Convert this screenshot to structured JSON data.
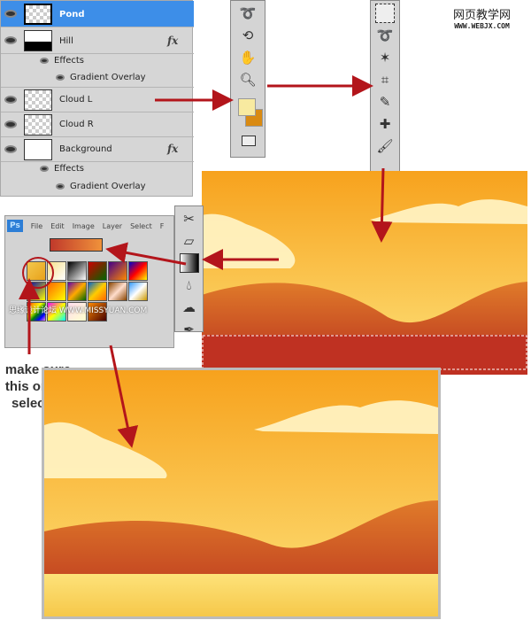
{
  "layers": [
    {
      "name": "Pond",
      "selected": true
    },
    {
      "name": "Hill",
      "fx": "fx"
    },
    {
      "name": "Effects"
    },
    {
      "name": "Gradient Overlay"
    },
    {
      "name": "Cloud L"
    },
    {
      "name": "Cloud R"
    },
    {
      "name": "Background",
      "fx": "fx"
    },
    {
      "name": "Effects"
    },
    {
      "name": "Gradient Overlay"
    }
  ],
  "watermark_top": {
    "line1": "网页教学网",
    "line2": "WWW.WEBJX.COM"
  },
  "watermark_mid": {
    "line1": "思缘设计论坛",
    "line2": "WWW.MISSYUAN.COM"
  },
  "ps_menu": {
    "logo": "Ps",
    "items": [
      "File",
      "Edit",
      "Image",
      "Layer",
      "Select",
      "F"
    ]
  },
  "note": "make sure this one is selected",
  "colors": {
    "foreground": "#f8eaa0",
    "background": "#d98a12",
    "accent_arrow": "#b3151b",
    "selection": "#1e87e8"
  }
}
